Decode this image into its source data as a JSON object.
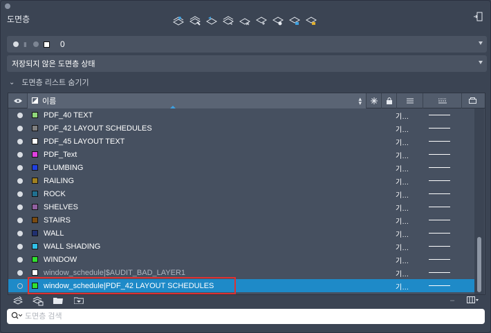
{
  "panel": {
    "title": "도면층"
  },
  "current_layer": {
    "name": "0"
  },
  "layer_state": {
    "value": "저장되지 않은 도면층 상태"
  },
  "collapse_label": "도면층 리스트 숨기기",
  "columns": {
    "name": "이름"
  },
  "rows": [
    {
      "name": "PDF_40 TEXT",
      "color": "#8fd67a",
      "linetype": "기…",
      "state": "normal"
    },
    {
      "name": "PDF_42 LAYOUT SCHEDULES",
      "color": "#808080",
      "linetype": "기…",
      "state": "normal"
    },
    {
      "name": "PDF_45 LAYOUT TEXT",
      "color": "#ffffff",
      "linetype": "기…",
      "state": "normal"
    },
    {
      "name": "PDF_Text",
      "color": "#e040e0",
      "linetype": "기…",
      "state": "normal"
    },
    {
      "name": "PLUMBING",
      "color": "#2040e0",
      "linetype": "기…",
      "state": "normal"
    },
    {
      "name": "RAILING",
      "color": "#a08020",
      "linetype": "기…",
      "state": "normal"
    },
    {
      "name": "ROCK",
      "color": "#207090",
      "linetype": "기…",
      "state": "normal"
    },
    {
      "name": "SHELVES",
      "color": "#9060a0",
      "linetype": "기…",
      "state": "normal"
    },
    {
      "name": "STAIRS",
      "color": "#7a4a10",
      "linetype": "기…",
      "state": "normal"
    },
    {
      "name": "WALL",
      "color": "#203070",
      "linetype": "기…",
      "state": "normal"
    },
    {
      "name": "WALL SHADING",
      "color": "#30c0e8",
      "linetype": "기…",
      "state": "normal"
    },
    {
      "name": "WINDOW",
      "color": "#30e030",
      "linetype": "기…",
      "state": "normal"
    },
    {
      "name": "window_schedule|$AUDIT_BAD_LAYER1",
      "color": "#ffffff",
      "linetype": "기…",
      "state": "dim"
    },
    {
      "name": "window_schedule|PDF_42 LAYOUT SCHEDULES",
      "color": "#30e030",
      "linetype": "기…",
      "state": "selected"
    }
  ],
  "search": {
    "placeholder": "도면층 검색"
  },
  "colors": {
    "accent": "#1e8ac8",
    "highlight": "#e03030",
    "background": "#3b4453"
  },
  "icons": {
    "toolbar": [
      "layer-properties-icon",
      "layer-match-icon",
      "layer-previous-icon",
      "layer-isolate-icon",
      "layer-unisolate-icon",
      "layer-freeze-icon",
      "layer-off-icon",
      "layer-lock-icon",
      "layer-unlock-icon"
    ],
    "bottom": [
      "new-layer-icon",
      "new-layer-vp-frozen-icon",
      "layer-states-icon",
      "layer-filter-icon",
      "minus-icon",
      "column-options-icon"
    ]
  }
}
